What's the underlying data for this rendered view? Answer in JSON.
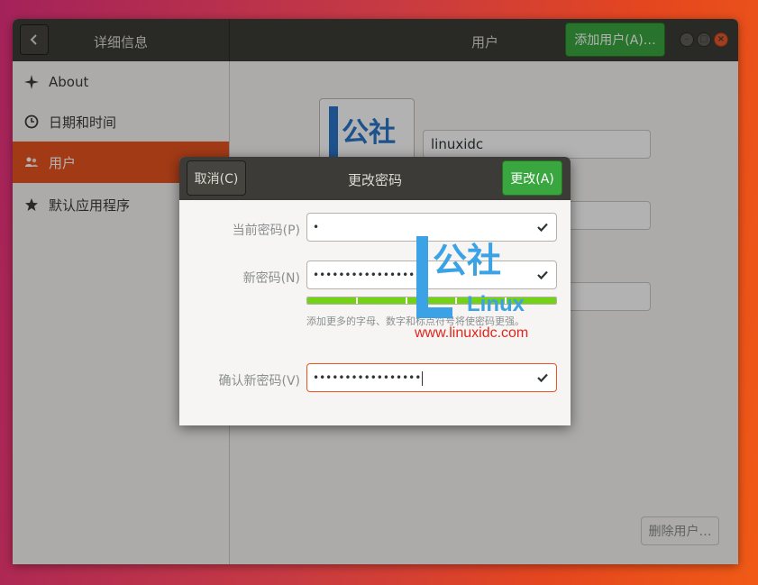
{
  "header": {
    "left_title": "详细信息",
    "center_title": "用户",
    "add_user_label": "添加用户(A)…"
  },
  "sidebar": {
    "items": [
      {
        "label": "About",
        "icon": "star-sparkle-icon"
      },
      {
        "label": "日期和时间",
        "icon": "clock-icon"
      },
      {
        "label": "用户",
        "icon": "users-icon",
        "active": true
      },
      {
        "label": "默认应用程序",
        "icon": "star-icon"
      }
    ]
  },
  "user_panel": {
    "username": "linuxidc",
    "delete_user_label": "删除用户…"
  },
  "dialog": {
    "title": "更改密码",
    "cancel_label": "取消(C)",
    "change_label": "更改(A)",
    "current_password_label": "当前密码(P)",
    "current_password_value": "•",
    "new_password_label": "新密码(N)",
    "new_password_value": "•••••••••••••••••",
    "strength_fraction": 1.0,
    "strength_hint": "添加更多的字母、数字和标点符号将使密码更强。",
    "confirm_password_label": "确认新密码(V)",
    "confirm_password_value": "•••••••••••••••••"
  },
  "watermark": {
    "cn_text": "公社",
    "linux_text": "Linux",
    "url": "www.linuxidc.com"
  },
  "colors": {
    "accent": "#e95420",
    "suggested": "#3aa63f",
    "headerbar": "#3c3b37",
    "strength": "#73d216"
  }
}
